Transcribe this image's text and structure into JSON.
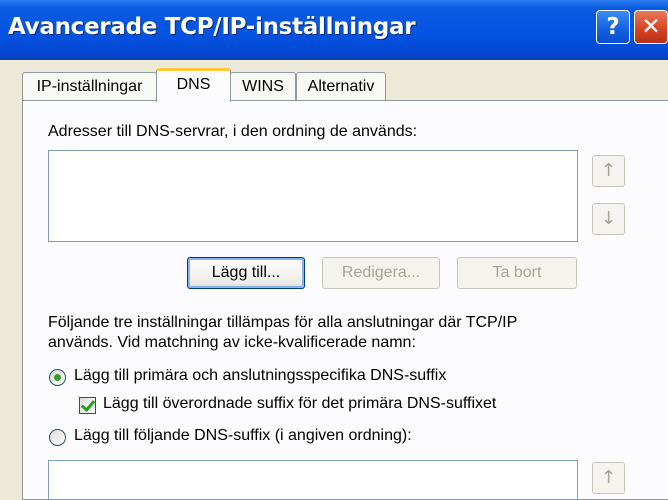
{
  "window": {
    "title": "Avancerade TCP/IP-inställningar",
    "help_glyph": "?",
    "close_glyph": "✕"
  },
  "tabs": [
    {
      "label": "IP-inställningar"
    },
    {
      "label": "DNS"
    },
    {
      "label": "WINS"
    },
    {
      "label": "Alternativ"
    }
  ],
  "dns": {
    "servers_label": "Adresser till DNS-servrar, i den ordning de används:",
    "up_glyph": "↑",
    "down_glyph": "↓",
    "add_label": "Lägg till...",
    "edit_label": "Redigera...",
    "remove_label": "Ta bort",
    "info_line1": "Följande tre inställningar tillämpas för alla anslutningar där TCP/IP",
    "info_line2": "används. Vid matchning av icke-kvalificerade namn:",
    "radio1_label": "Lägg till primära och anslutningsspecifika DNS-suffix",
    "checkbox_label": "Lägg till överordnade suffix för det primära DNS-suffixet",
    "radio2_label": "Lägg till följande DNS-suffix (i angiven ordning):"
  },
  "colors": {
    "titlebar": "#0554e3",
    "dialog": "#ece9d8",
    "tab_highlight": "#ffc83c"
  }
}
